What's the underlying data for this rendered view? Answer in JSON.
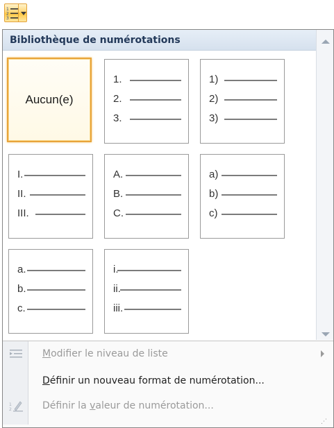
{
  "gallery": {
    "title": "Bibliothèque de numérotations",
    "none_label": "Aucun(e)",
    "tiles": [
      {
        "markers": [
          "1.",
          "2.",
          "3."
        ]
      },
      {
        "markers": [
          "1)",
          "2)",
          "3)"
        ]
      },
      {
        "markers": [
          "I.",
          "II.",
          "III."
        ]
      },
      {
        "markers": [
          "A.",
          "B.",
          "C."
        ]
      },
      {
        "markers": [
          "a)",
          "b)",
          "c)"
        ]
      },
      {
        "markers": [
          "a.",
          "b.",
          "c."
        ]
      },
      {
        "markers": [
          "i.",
          "ii.",
          "iii."
        ]
      }
    ]
  },
  "menu": {
    "items": [
      {
        "label_pre": "",
        "label_key": "M",
        "label_post": "odifier le niveau de liste",
        "enabled": false,
        "icon": "indent-level-icon",
        "has_submenu": true
      },
      {
        "label_pre": "",
        "label_key": "D",
        "label_post": "éfinir un nouveau format de numérotation...",
        "enabled": true,
        "icon": "",
        "has_submenu": false
      },
      {
        "label_pre": "Définir la ",
        "label_key": "v",
        "label_post": "aleur de numérotation...",
        "enabled": false,
        "icon": "set-numbering-value-icon",
        "has_submenu": false
      }
    ]
  },
  "colors": {
    "selected_border": "#e8a43a",
    "header_bg": "#dfe8f3",
    "disabled_text": "#9a9a9a"
  }
}
